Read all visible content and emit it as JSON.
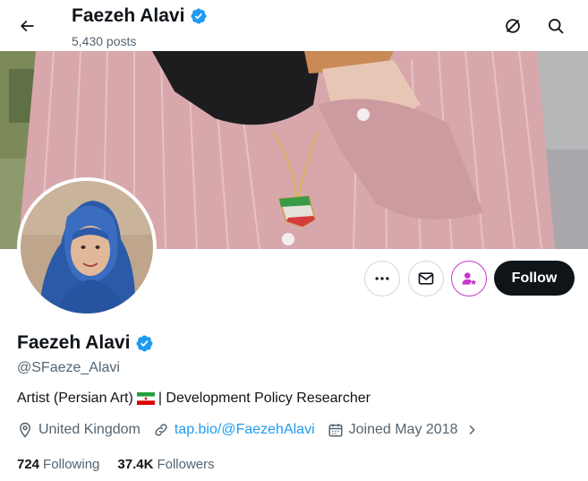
{
  "header": {
    "name": "Faezeh Alavi",
    "posts": "5,430 posts"
  },
  "profile": {
    "name": "Faezeh Alavi",
    "handle": "@SFaeze_Alavi",
    "bio_before_flag": "Artist (Persian Art)",
    "bio_after_flag": "| Development Policy Researcher",
    "location": "United Kingdom",
    "website": "tap.bio/@FaezehAlavi",
    "joined": "Joined May 2018",
    "following_count": "724",
    "following_label": "Following",
    "followers_count": "37.4K",
    "followers_label": "Followers"
  },
  "actions": {
    "follow_label": "Follow"
  },
  "colors": {
    "accent": "#1d9bf0",
    "verified": "#1d9bf0",
    "subscribe": "#c936cc",
    "follow_bg": "#0f1419"
  },
  "icons": [
    "back-arrow-icon",
    "grok-icon",
    "search-icon",
    "more-icon",
    "mail-icon",
    "subscribe-icon",
    "verified-badge-icon",
    "location-icon",
    "link-icon",
    "calendar-icon",
    "chevron-right-icon",
    "iran-flag-icon"
  ]
}
